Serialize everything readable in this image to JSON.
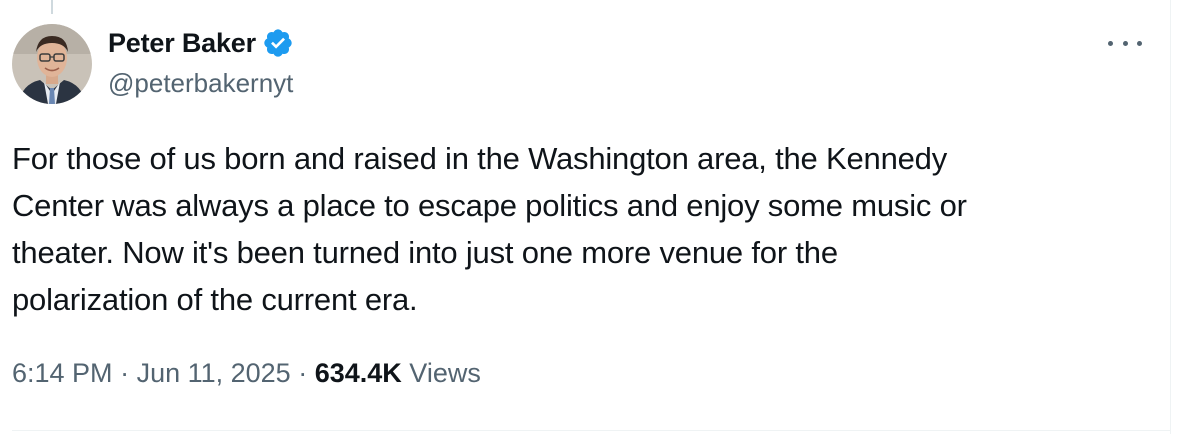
{
  "author": {
    "display_name": "Peter Baker",
    "handle": "@peterbakernyt",
    "verified": true,
    "verified_color": "#1d9bf0"
  },
  "tweet": {
    "text_lines": [
      "For those of us born and raised in the Washington area, the Kennedy",
      "Center was always a place to escape politics and enjoy some music or",
      "theater. Now it's been turned into just one more venue for the",
      "polarization of the current era."
    ]
  },
  "meta": {
    "time": "6:14 PM",
    "separator": " · ",
    "date": "Jun 11, 2025",
    "views_count": "634.4K",
    "views_label": "Views"
  },
  "icons": {
    "more": "more-options-icon",
    "verified": "verified-badge-icon"
  },
  "colors": {
    "text_primary": "#0f1419",
    "text_secondary": "#536471",
    "accent": "#1d9bf0"
  }
}
